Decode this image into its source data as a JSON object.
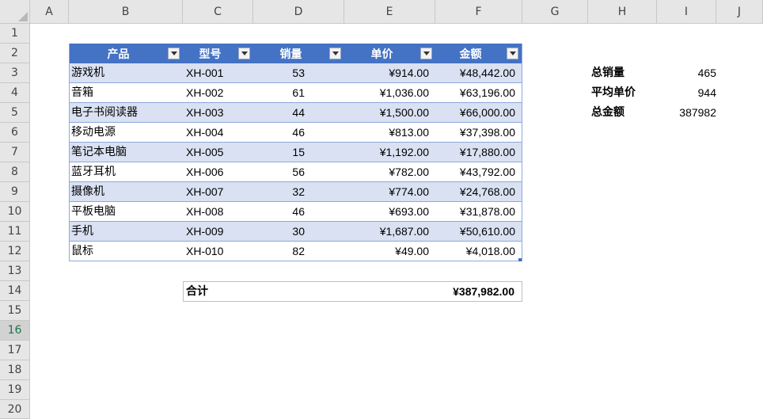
{
  "columns": [
    "A",
    "B",
    "C",
    "D",
    "E",
    "F",
    "G",
    "H",
    "I",
    "J"
  ],
  "rows": [
    "1",
    "2",
    "3",
    "4",
    "5",
    "6",
    "7",
    "8",
    "9",
    "10",
    "11",
    "12",
    "13",
    "14",
    "15",
    "16",
    "17",
    "18",
    "19",
    "20"
  ],
  "selected_row": "16",
  "table": {
    "headers": [
      "产品",
      "型号",
      "销量",
      "单价",
      "金额"
    ],
    "rows": [
      [
        "游戏机",
        "XH-001",
        "53",
        "¥914.00",
        "¥48,442.00"
      ],
      [
        "音箱",
        "XH-002",
        "61",
        "¥1,036.00",
        "¥63,196.00"
      ],
      [
        "电子书阅读器",
        "XH-003",
        "44",
        "¥1,500.00",
        "¥66,000.00"
      ],
      [
        "移动电源",
        "XH-004",
        "46",
        "¥813.00",
        "¥37,398.00"
      ],
      [
        "笔记本电脑",
        "XH-005",
        "15",
        "¥1,192.00",
        "¥17,880.00"
      ],
      [
        "蓝牙耳机",
        "XH-006",
        "56",
        "¥782.00",
        "¥43,792.00"
      ],
      [
        "摄像机",
        "XH-007",
        "32",
        "¥774.00",
        "¥24,768.00"
      ],
      [
        "平板电脑",
        "XH-008",
        "46",
        "¥693.00",
        "¥31,878.00"
      ],
      [
        "手机",
        "XH-009",
        "30",
        "¥1,687.00",
        "¥50,610.00"
      ],
      [
        "鼠标",
        "XH-010",
        "82",
        "¥49.00",
        "¥4,018.00"
      ]
    ]
  },
  "total": {
    "label": "合计",
    "value": "¥387,982.00"
  },
  "summary": [
    {
      "label": "总销量",
      "value": "465"
    },
    {
      "label": "平均单价",
      "value": "944"
    },
    {
      "label": "总金额",
      "value": "387982"
    }
  ],
  "colors": {
    "header_fill": "#4472c4",
    "band_fill": "#d9e1f2",
    "border": "#8ea9db"
  }
}
